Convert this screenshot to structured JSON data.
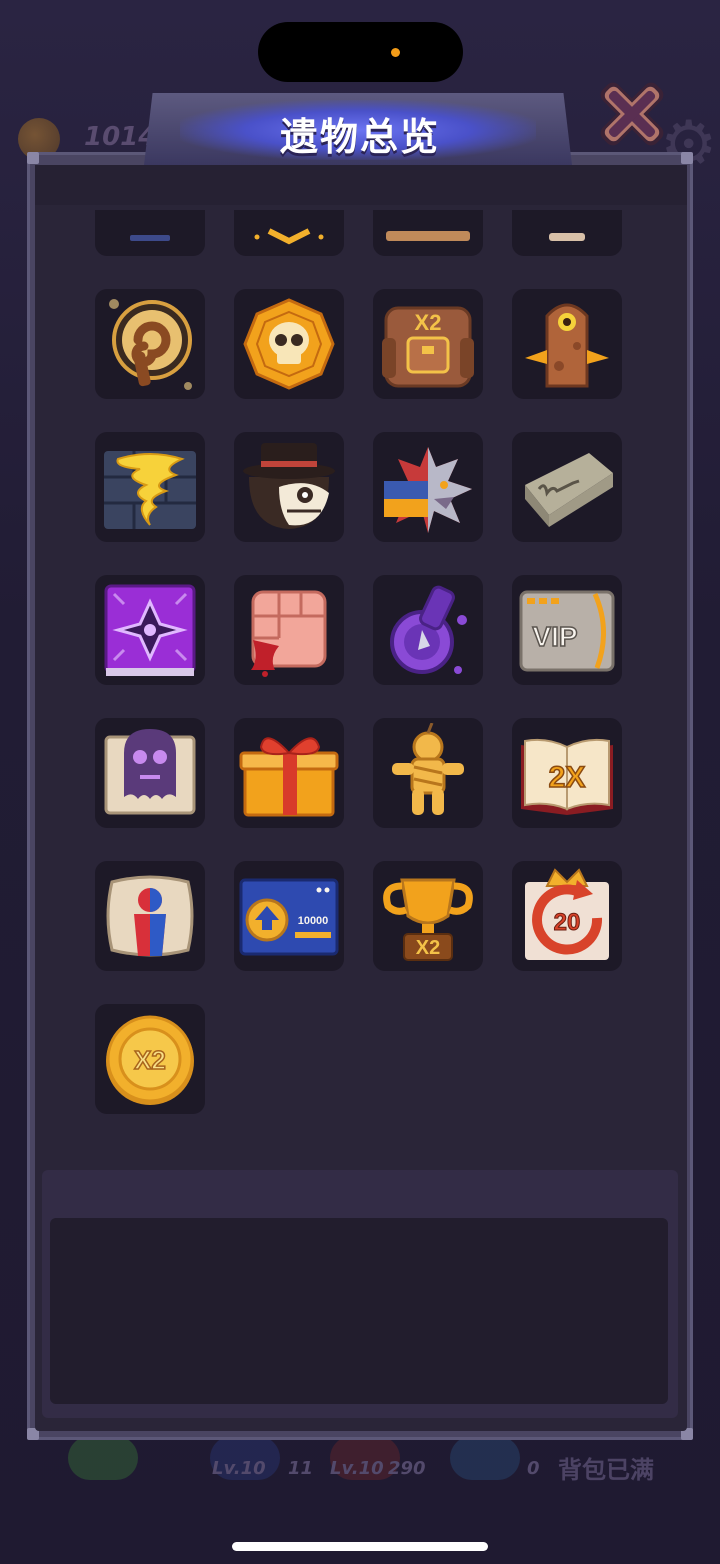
{
  "background": {
    "coin_count": "1014",
    "levels": [
      {
        "level": "Lv.10",
        "count": "11"
      },
      {
        "level": "Lv.10",
        "count": "290"
      }
    ],
    "extra_count": "0",
    "bag_status": "背包已满"
  },
  "dialog": {
    "title": "遗物总览",
    "close_icon": "close-x-icon"
  },
  "relics": [
    {
      "icon": "partial-relic-1"
    },
    {
      "icon": "partial-relic-2"
    },
    {
      "icon": "partial-relic-3"
    },
    {
      "icon": "partial-relic-4"
    },
    {
      "icon": "spiral-staff-icon"
    },
    {
      "icon": "golden-skull-web-icon"
    },
    {
      "icon": "x2-backpack-icon",
      "label": "X2"
    },
    {
      "icon": "one-eyed-monolith-icon"
    },
    {
      "icon": "tornado-icon"
    },
    {
      "icon": "gentleman-mask-icon"
    },
    {
      "icon": "flag-wolf-icon"
    },
    {
      "icon": "eraser-icon"
    },
    {
      "icon": "purple-spellbook-icon"
    },
    {
      "icon": "bloody-fist-icon"
    },
    {
      "icon": "purple-potion-icon"
    },
    {
      "icon": "vip-card-icon",
      "label": "VIP"
    },
    {
      "icon": "ghost-scroll-icon"
    },
    {
      "icon": "gift-box-icon"
    },
    {
      "icon": "mummy-doll-icon"
    },
    {
      "icon": "2x-book-icon",
      "label": "2X"
    },
    {
      "icon": "split-pillow-icon"
    },
    {
      "icon": "upgrade-card-icon",
      "label": "10000"
    },
    {
      "icon": "x2-trophy-icon",
      "label": "X2"
    },
    {
      "icon": "crown-20-icon",
      "label": "20"
    },
    {
      "icon": "x2-gold-coin-icon",
      "label": "X2"
    }
  ]
}
